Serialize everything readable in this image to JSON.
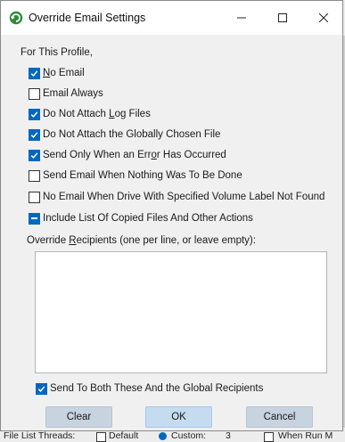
{
  "dialog": {
    "title": "Override Email Settings"
  },
  "profile_label": "For This Profile,",
  "options": [
    {
      "label": "No Email",
      "state": "checked"
    },
    {
      "label": "Email Always",
      "state": "unchecked"
    },
    {
      "label": "Do Not Attach Log Files",
      "state": "checked"
    },
    {
      "label": "Do Not Attach the Globally Chosen File",
      "state": "checked"
    },
    {
      "label": "Send Only When an Error Has Occurred",
      "state": "checked"
    },
    {
      "label": "Send Email When Nothing Was To Be Done",
      "state": "unchecked"
    },
    {
      "label": "No Email When Drive With Specified Volume Label  Not Found",
      "state": "unchecked"
    },
    {
      "label": "Include List Of Copied Files And Other Actions",
      "state": "indeterminate"
    }
  ],
  "recipients": {
    "label": "Override Recipients (one per line, or leave empty):",
    "value": ""
  },
  "send_both": {
    "label": "Send To Both These And the Global Recipients",
    "state": "checked"
  },
  "buttons": {
    "clear": "Clear",
    "ok": "OK",
    "cancel": "Cancel"
  },
  "underlay": {
    "threads_label": "File List Threads:",
    "default_label": "Default",
    "custom_label": "Custom:",
    "custom_value": "3",
    "right_label": "When Run M"
  },
  "colors": {
    "accent": "#0067c0",
    "dialog_bg": "#f0f0f0",
    "button_bg": "#c7d3df",
    "ok_bg": "#c5dcf0"
  }
}
